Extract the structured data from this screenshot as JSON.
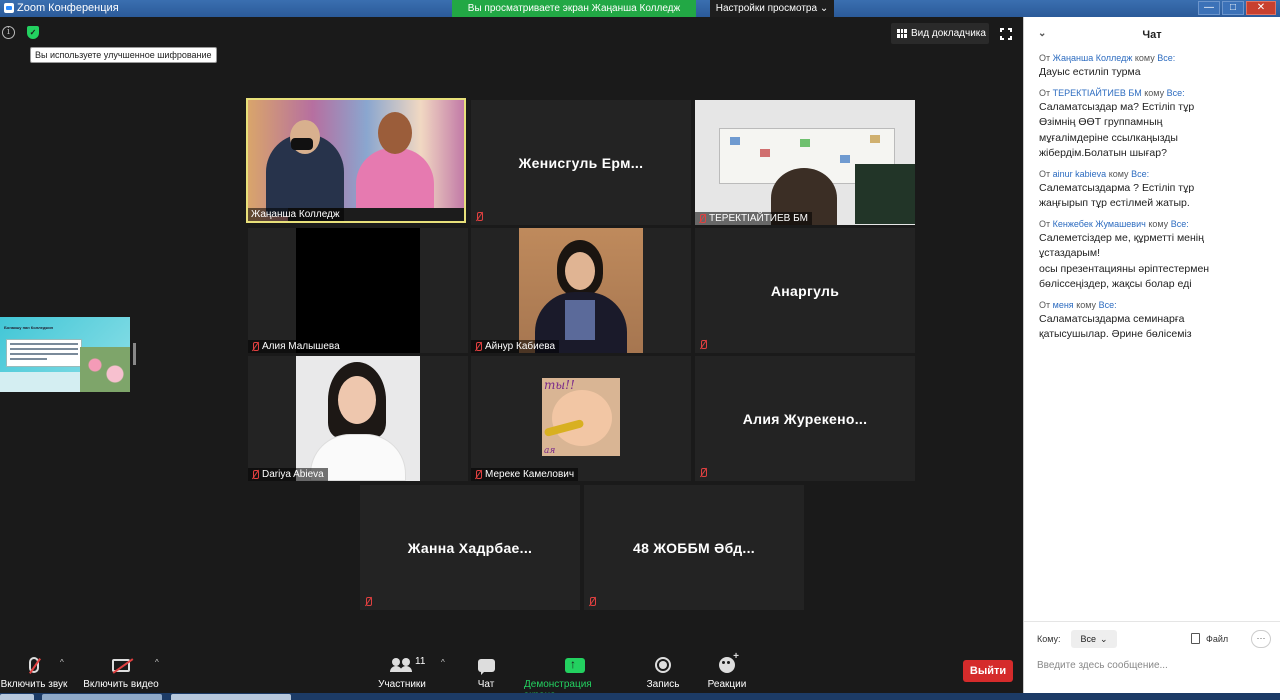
{
  "window": {
    "title": "Zoom Конференция",
    "share_banner": "Вы просматриваете экран Жаңанша Колледж",
    "view_options": "Настройки просмотра",
    "controls": [
      "—",
      "□",
      "✕"
    ]
  },
  "meeting": {
    "encryption_tooltip": "Вы используете улучшенное шифрование",
    "speaker_view_label": "Вид докладчика",
    "share_thumbnail_title": "Бонакшу пан Колледжин",
    "share_thumb_caption_top": "ты!!",
    "share_thumb_caption_bottom": "ая",
    "participants": [
      {
        "name": "Жаңанша Колледж",
        "video": true
      },
      {
        "name": "Женисгуль  Ерм...",
        "video": false
      },
      {
        "name": "ТЕРЕКТІАЙТИЕВ БМ",
        "video": true
      },
      {
        "name": "Алия Малышева",
        "video": true
      },
      {
        "name": "Айнур Кабиева",
        "video": true
      },
      {
        "name": "Анаргуль",
        "video": false
      },
      {
        "name": "Dariya Abieva",
        "video": true
      },
      {
        "name": "Мереке  Камелович",
        "video": true
      },
      {
        "name": "Алия  Журекено...",
        "video": false
      },
      {
        "name": "Жанна  Хадрбае...",
        "video": false
      },
      {
        "name": "48 ЖОББМ Әбд...",
        "video": false
      }
    ]
  },
  "toolbar": {
    "unmute_label": "Включить звук",
    "start_video_label": "Включить видео",
    "participants_label": "Участники",
    "participants_count": "11",
    "chat_label": "Чат",
    "share_screen_label": "Демонстрация экрана",
    "record_label": "Запись",
    "reactions_label": "Реакции",
    "leave_label": "Выйти"
  },
  "chat": {
    "title": "Чат",
    "from_word": "От",
    "to_word": "кому",
    "messages": [
      {
        "from": "Жаңанша Колледж",
        "to": "Все:",
        "lines": [
          "Дауыс естиліп турма"
        ]
      },
      {
        "from": "ТЕРЕКТІАЙТИЕВ БМ",
        "to": "Все:",
        "lines": [
          "Саламатсыздар ма? Естіліп тұр",
          "Өзімнің ӨӨТ группамның",
          "мұғалімдеріне ссылкаңызды",
          "жібердім.Болатын шығар?"
        ]
      },
      {
        "from": "ainur kabieva",
        "to": "Все:",
        "lines": [
          "Салематсыздарма ? Естіліп тұр",
          "жаңғырып тұр естілмей  жатыр."
        ]
      },
      {
        "from": "Кенжебек Жумашевич",
        "to": "Все:",
        "lines": [
          "Салеметсіздер ме, құрметті менің",
          "ұстаздарым!",
          "осы презентацияны әріптестермен",
          "бөліссеңіздер, жақсы болар еді"
        ]
      },
      {
        "from": "меня",
        "to": "Все:",
        "lines": [
          "Саламатсыздарма семинарға",
          "қатысушылар. Әрине бөлісеміз"
        ],
        "self": true
      }
    ],
    "to_label": "Кому:",
    "to_value": "Все",
    "file_label": "Файл",
    "more_label": "···",
    "input_placeholder": "Введите здесь сообщение..."
  }
}
